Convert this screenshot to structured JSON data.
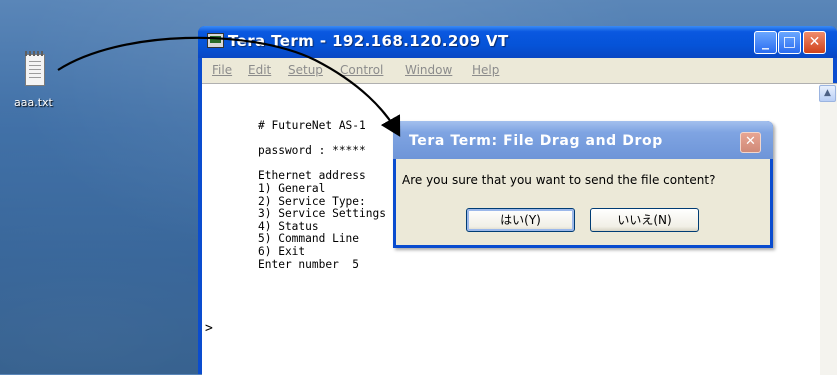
{
  "desktop": {
    "icon_label": "aaa.txt",
    "icon_name": "text-file-icon"
  },
  "window": {
    "title": "Tera Term - 192.168.120.209 VT",
    "menu": [
      "File",
      "Edit",
      "Setup",
      "Control",
      "Window",
      "Help"
    ],
    "buttons": {
      "minimize": "_",
      "maximize": "□",
      "close": "✕"
    }
  },
  "terminal": {
    "lines": [
      "# FutureNet AS-1",
      "",
      "password : *****",
      "",
      "Ethernet address",
      "1) General",
      "2) Service Type:",
      "3) Service Settings",
      "4) Status",
      "5) Command Line",
      "6) Exit",
      "Enter number  5"
    ],
    "prompt": ">"
  },
  "dialog": {
    "title": "Tera Term: File Drag and Drop",
    "close": "✕",
    "message": "Are you sure that you want to send the file content?",
    "yes_label": "はい(Y)",
    "no_label": "いいえ(N)"
  }
}
